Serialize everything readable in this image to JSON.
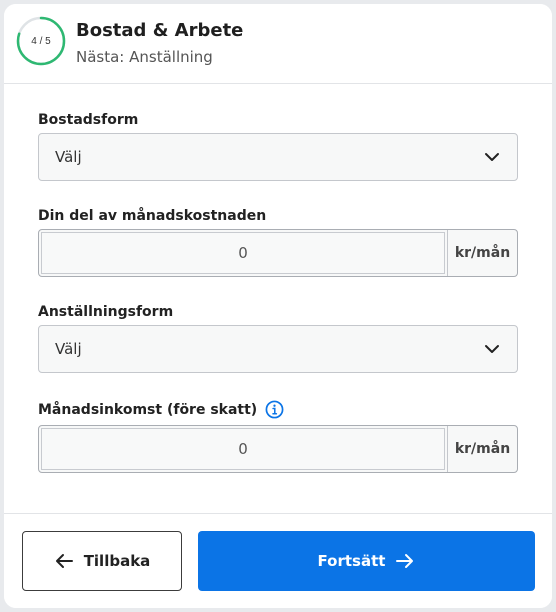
{
  "header": {
    "step_text": "4 / 5",
    "step_progress": 0.8,
    "title": "Bostad & Arbete",
    "subtitle": "Nästa: Anställning"
  },
  "fields": {
    "housing": {
      "label": "Bostadsform",
      "value": "Välj"
    },
    "housing_cost": {
      "label": "Din del av månadskostnaden",
      "value": "0",
      "suffix": "kr/mån"
    },
    "employment": {
      "label": "Anställningsform",
      "value": "Välj"
    },
    "income": {
      "label": "Månadsinkomst (före skatt)",
      "value": "0",
      "suffix": "kr/mån"
    }
  },
  "footer": {
    "back_label": "Tillbaka",
    "next_label": "Fortsätt"
  },
  "colors": {
    "accent": "#0b74e6",
    "progress": "#2eb872"
  },
  "icons": [
    "chevron-down-icon",
    "info-icon",
    "arrow-left-icon",
    "arrow-right-icon"
  ]
}
